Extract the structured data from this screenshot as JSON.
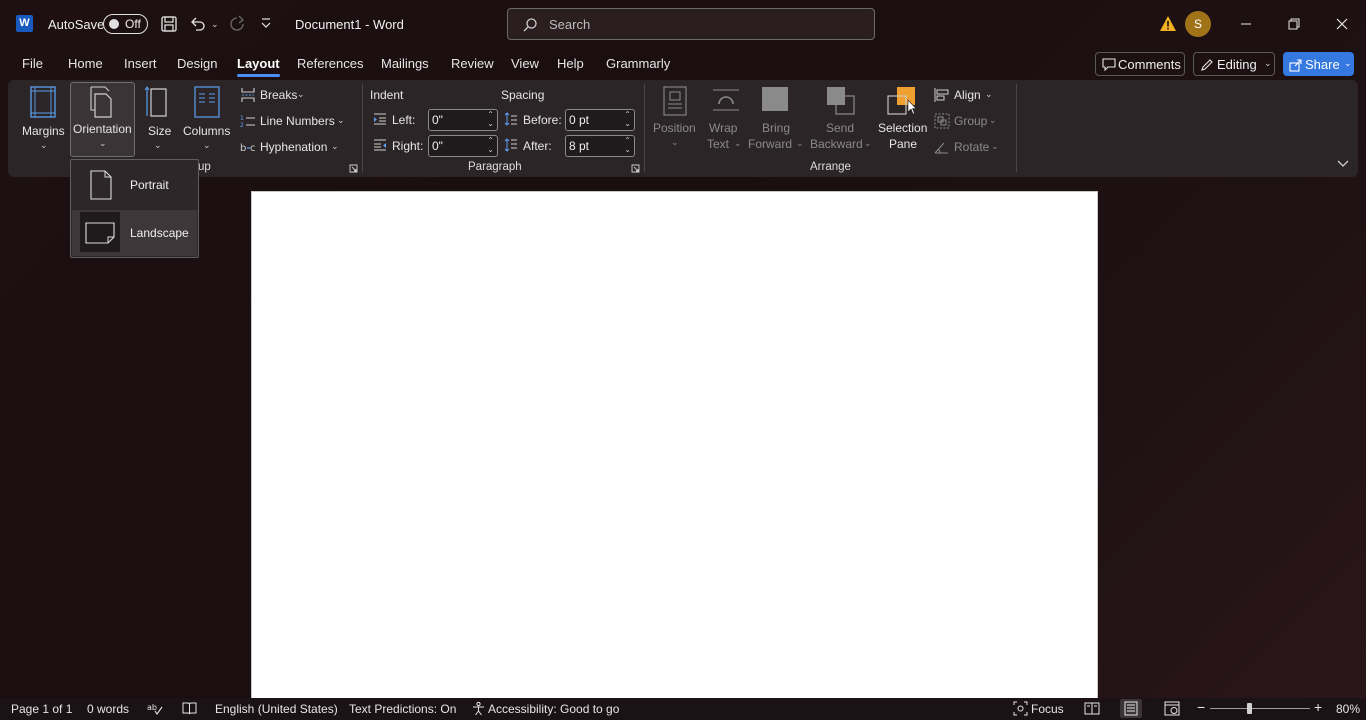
{
  "titlebar": {
    "app_icon_letter": "W",
    "autosave_label": "AutoSave",
    "autosave_state": "Off",
    "document_title": "Document1  -  Word",
    "search_placeholder": "Search",
    "avatar_initial": "S"
  },
  "menu": {
    "tabs": [
      "File",
      "Home",
      "Insert",
      "Design",
      "Layout",
      "References",
      "Mailings",
      "Review",
      "View",
      "Help",
      "Grammarly"
    ],
    "active_tab": "Layout",
    "comments_label": "Comments",
    "editing_label": "Editing",
    "share_label": "Share"
  },
  "ribbon": {
    "page_setup": {
      "margins": "Margins",
      "orientation": "Orientation",
      "size": "Size",
      "columns": "Columns",
      "breaks": "Breaks",
      "line_numbers": "Line Numbers",
      "hyphenation": "Hyphenation",
      "group_label_partial": "up"
    },
    "paragraph": {
      "indent_label": "Indent",
      "spacing_label": "Spacing",
      "left_label": "Left:",
      "left_value": "0\"",
      "right_label": "Right:",
      "right_value": "0\"",
      "before_label": "Before:",
      "before_value": "0 pt",
      "after_label": "After:",
      "after_value": "8 pt",
      "group_label": "Paragraph"
    },
    "arrange": {
      "position": "Position",
      "wrap_text_1": "Wrap",
      "wrap_text_2": "Text",
      "bring_forward_1": "Bring",
      "bring_forward_2": "Forward",
      "send_backward_1": "Send",
      "send_backward_2": "Backward",
      "selection_pane_1": "Selection",
      "selection_pane_2": "Pane",
      "align": "Align",
      "group": "Group",
      "rotate": "Rotate",
      "group_label": "Arrange"
    }
  },
  "orientation_dropdown": {
    "portrait": "Portrait",
    "landscape": "Landscape",
    "highlighted": "Landscape"
  },
  "statusbar": {
    "page": "Page 1 of 1",
    "words": "0 words",
    "language": "English (United States)",
    "text_predictions": "Text Predictions: On",
    "accessibility": "Accessibility: Good to go",
    "focus": "Focus",
    "zoom": "80%"
  },
  "colors": {
    "accent": "#4f8ef7",
    "share": "#3478e0",
    "word_blue": "#185abd",
    "avatar": "#a07318",
    "warning": "#f2b01e",
    "selection_pane_icon": "#f0a030"
  }
}
